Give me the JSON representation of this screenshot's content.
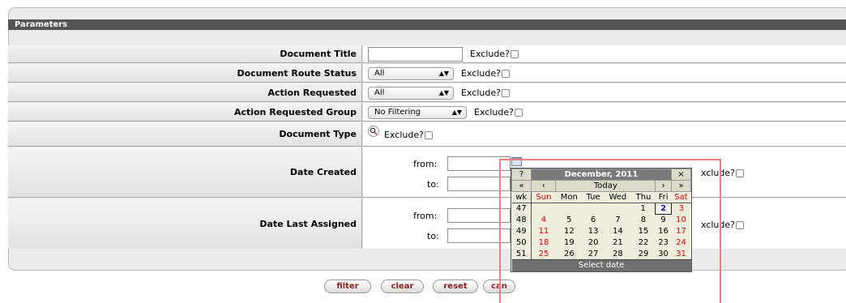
{
  "panel": {
    "header": "Parameters"
  },
  "fields": {
    "document_title": {
      "label": "Document Title",
      "value": "",
      "exclude": "Exclude?"
    },
    "route_status": {
      "label": "Document Route Status",
      "selected": "All",
      "exclude": "Exclude?"
    },
    "action_requested": {
      "label": "Action Requested",
      "selected": "All",
      "exclude": "Exclude?"
    },
    "action_group": {
      "label": "Action Requested Group",
      "selected": "No Filtering",
      "exclude": "Exclude?"
    },
    "document_type": {
      "label": "Document Type",
      "exclude": "Exclude?"
    },
    "date_created": {
      "label": "Date Created",
      "from_label": "from:",
      "to_label": "to:",
      "exclude": "xclude?"
    },
    "date_last_assigned": {
      "label": "Date Last Assigned",
      "from_label": "from:",
      "to_label": "to:",
      "exclude": "xclude?"
    }
  },
  "buttons": {
    "filter": "filter",
    "clear": "clear",
    "reset": "reset",
    "cancel": "can"
  },
  "calendar": {
    "help": "?",
    "title": "December, 2011",
    "close": "×",
    "prev_year": "«",
    "prev_month": "‹",
    "today": "Today",
    "next_month": "›",
    "next_year": "»",
    "weekday_headers": [
      "wk",
      "Sun",
      "Mon",
      "Tue",
      "Wed",
      "Thu",
      "Fri",
      "Sat"
    ],
    "weeks": [
      [
        "47",
        "",
        "",
        "",
        "",
        "1",
        "2",
        "3"
      ],
      [
        "48",
        "4",
        "5",
        "6",
        "7",
        "8",
        "9",
        "10"
      ],
      [
        "49",
        "11",
        "12",
        "13",
        "14",
        "15",
        "16",
        "17"
      ],
      [
        "50",
        "18",
        "19",
        "20",
        "21",
        "22",
        "23",
        "24"
      ],
      [
        "51",
        "25",
        "26",
        "27",
        "28",
        "29",
        "30",
        "31"
      ]
    ],
    "footer": "Select date"
  }
}
